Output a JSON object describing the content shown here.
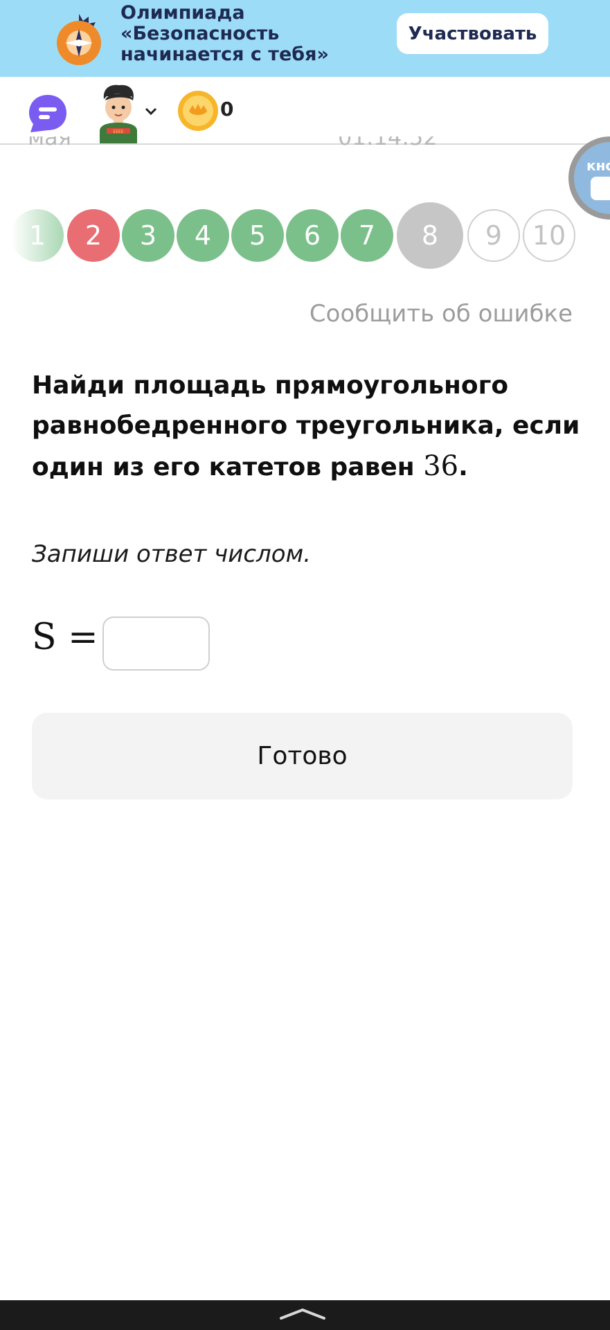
{
  "banner": {
    "title_lines": [
      "Олимпиада",
      "«Безопасность",
      "начинается с тебя»"
    ],
    "button_label": "Участвовать"
  },
  "header": {
    "coin_count": "0",
    "partial_date": "мая",
    "partial_time": "01:14:52"
  },
  "floating_button": {
    "label": "кно"
  },
  "progress": {
    "steps": [
      {
        "label": "1",
        "status": "correct-faded"
      },
      {
        "label": "2",
        "status": "wrong"
      },
      {
        "label": "3",
        "status": "correct"
      },
      {
        "label": "4",
        "status": "correct"
      },
      {
        "label": "5",
        "status": "correct"
      },
      {
        "label": "6",
        "status": "correct"
      },
      {
        "label": "7",
        "status": "correct"
      },
      {
        "label": "8",
        "status": "current"
      },
      {
        "label": "9",
        "status": "pending"
      },
      {
        "label": "10",
        "status": "pending"
      }
    ]
  },
  "report_link": "Сообщить об ошибке",
  "task": {
    "question_text": "Найди площадь прямоугольного равнобедренного треугольника, если один из его катетов равен ",
    "question_number": "36",
    "question_end": ".",
    "hint": "Запиши ответ числом.",
    "answer_label": "S =",
    "answer_value": ""
  },
  "done_button": "Готово",
  "colors": {
    "banner_bg": "#9ddcf7",
    "correct": "#7bc08a",
    "wrong": "#e86e73",
    "current": "#c6c6c6",
    "chat_icon": "#7a5cf0",
    "coin": "#f7b52a"
  }
}
